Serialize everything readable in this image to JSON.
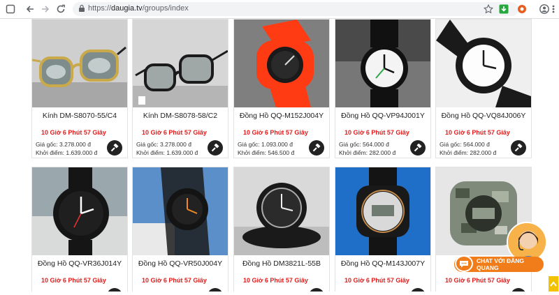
{
  "browser": {
    "url_scheme": "https://",
    "url_host": "daugia.tv",
    "url_path": "/groups/index",
    "icons": [
      "sidebar-toggle-icon",
      "back-icon",
      "forward-icon",
      "reload-icon",
      "lock-icon",
      "star-icon",
      "download-icon",
      "extension-icon",
      "account-icon",
      "menu-icon"
    ]
  },
  "products": [
    {
      "name": "Kính DM-S8070-55/C4",
      "timer": "10 Giờ 6 Phút 57 Giây",
      "original_price": "Giá gốc: 3.278.000 đ",
      "start_price": "Khởi điểm: 1.639.000 đ",
      "image": "sunglasses-gold"
    },
    {
      "name": "Kính DM-S8078-58/C2",
      "timer": "10 Giờ 6 Phút 57 Giây",
      "original_price": "Giá gốc: 3.278.000 đ",
      "start_price": "Khởi điểm: 1.639.000 đ",
      "image": "sunglasses-black"
    },
    {
      "name": "Đồng Hồ QQ-M152J004Y",
      "timer": "10 Giờ 6 Phút 57 Giây",
      "original_price": "Giá gốc: 1.093.000 đ",
      "start_price": "Khởi điểm: 546.500 đ",
      "image": "watch-red"
    },
    {
      "name": "Đồng Hồ QQ-VP94J001Y",
      "timer": "10 Giờ 6 Phút 57 Giây",
      "original_price": "Giá gốc: 564.000 đ",
      "start_price": "Khởi điểm: 282.000 đ",
      "image": "watch-black-white"
    },
    {
      "name": "Đồng Hồ QQ-VQ84J006Y",
      "timer": "10 Giờ 6 Phút 57 Giây",
      "original_price": "Giá gốc: 564.000 đ",
      "start_price": "Khởi điểm: 282.000 đ",
      "image": "watch-white-dial"
    },
    {
      "name": "Đồng Hồ QQ-VR36J014Y",
      "timer": "10 Giờ 6 Phút 57 Giây",
      "original_price": "",
      "start_price": "",
      "image": "watch-black-numbers"
    },
    {
      "name": "Đồng Hồ QQ-VR50J004Y",
      "timer": "10 Giờ 6 Phút 57 Giây",
      "original_price": "",
      "start_price": "",
      "image": "watch-black-orange"
    },
    {
      "name": "Đồng Hồ DM3821L-55B",
      "timer": "10 Giờ 6 Phút 57 Giây",
      "original_price": "",
      "start_price": "",
      "image": "watch-black-steel"
    },
    {
      "name": "Đồng Hồ QQ-M143J007Y",
      "timer": "10 Giờ 6 Phút 57 Giây",
      "original_price": "",
      "start_price": "",
      "image": "watch-digital-blue"
    },
    {
      "name": "Đồ",
      "timer": "10 Giờ 6 Phút 57 Giây",
      "original_price": "",
      "start_price": "",
      "image": "watch-camo"
    }
  ],
  "chat": {
    "label": "CHAT VỚI ĐĂNG QUANG"
  }
}
